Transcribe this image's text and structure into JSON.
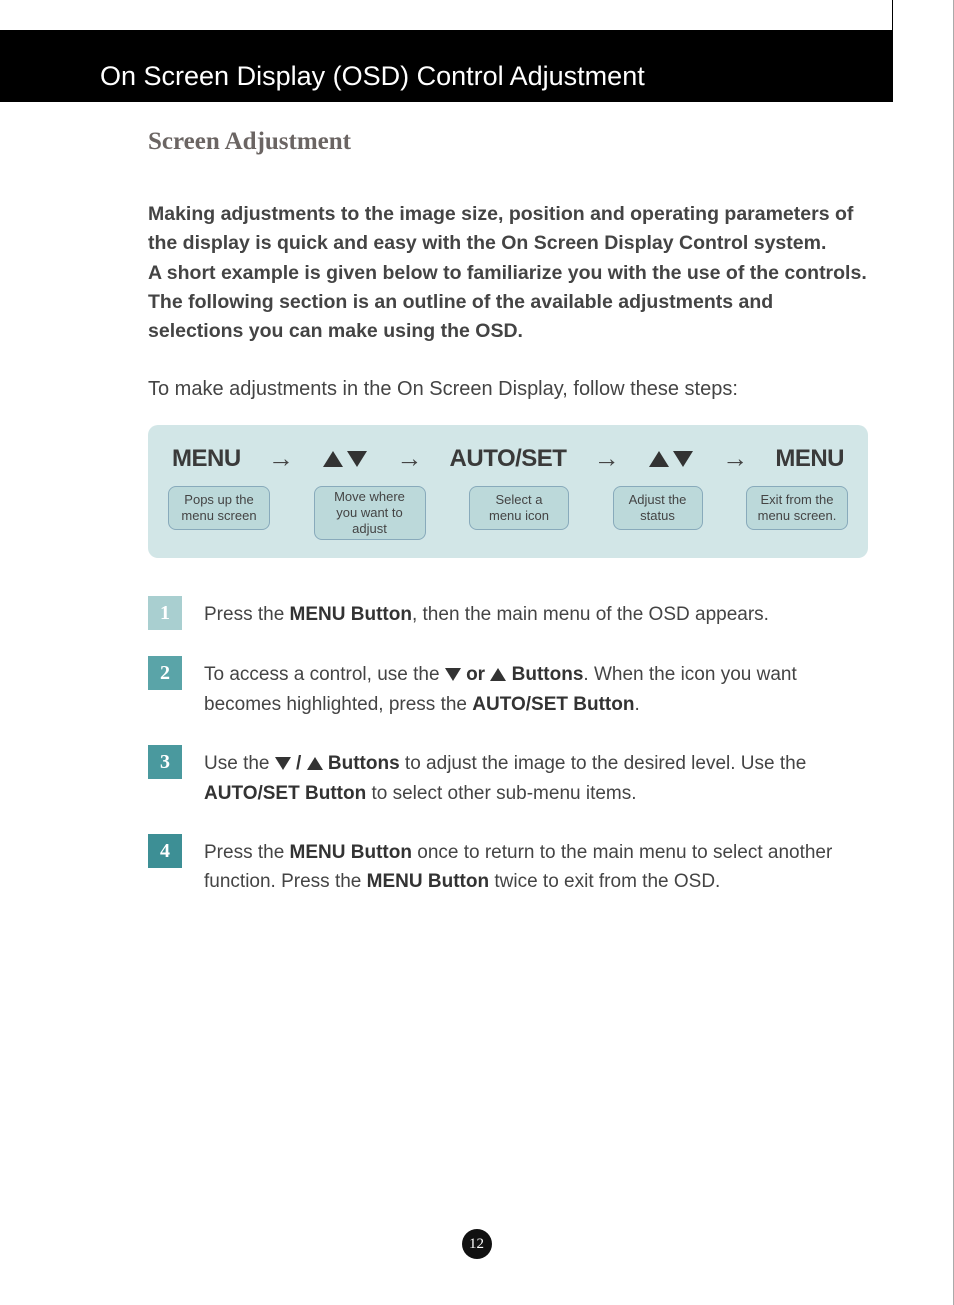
{
  "header_title": "On Screen Display (OSD) Control Adjustment",
  "section_title": "Screen Adjustment",
  "intro": "Making adjustments to the image size, position and operating parameters of the display is quick and easy with the On Screen Display Control system.\nA short example is given below to familiarize you with the use of the controls. The following section is an outline of the available adjustments and selections you can make using the OSD.",
  "lead": "To make adjustments in the On Screen Display, follow these steps:",
  "flow": {
    "labels": {
      "menu": "MENU",
      "autoset": "AUTO/SET",
      "menu2": "MENU"
    },
    "descs": {
      "d1": "Pops up the menu screen",
      "d2": "Move where you want to adjust",
      "d3": "Select a menu icon",
      "d4": "Adjust the status",
      "d5": "Exit from the menu screen."
    }
  },
  "steps": {
    "n1": "1",
    "n2": "2",
    "n3": "3",
    "n4": "4",
    "s1_a": "Press the ",
    "s1_b": "MENU Button",
    "s1_c": ", then the main menu of the OSD appears.",
    "s2_a": "To access a control, use the  ",
    "s2_b": " or ",
    "s2_c": " Buttons",
    "s2_d": ". When the icon you want becomes highlighted, press the  ",
    "s2_e": "AUTO/SET Button",
    "s2_f": ".",
    "s3_a": "Use the ",
    "s3_b": " / ",
    "s3_c": " Buttons",
    "s3_d": " to adjust the image to the desired level. Use the ",
    "s3_e": "AUTO/SET Button",
    "s3_f": " to select other sub-menu items.",
    "s4_a": "Press the ",
    "s4_b": "MENU Button",
    "s4_c": " once to return to the main menu to select another function. Press the ",
    "s4_d": "MENU Button",
    "s4_e": " twice to exit from the OSD."
  },
  "page_number": "12"
}
